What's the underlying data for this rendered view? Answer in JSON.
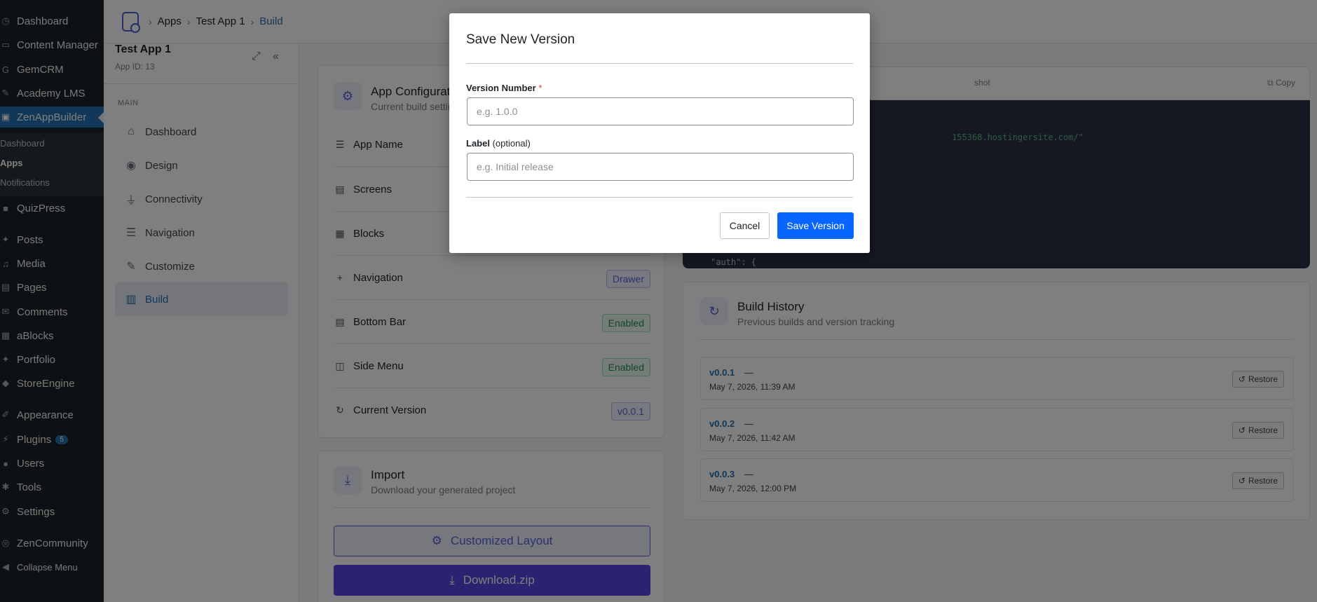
{
  "wp_menu": {
    "items": [
      {
        "label": "Dashboard",
        "icon": "dashboard-icon"
      },
      {
        "label": "Content Manager",
        "icon": "folder-icon"
      },
      {
        "label": "GemCRM",
        "icon": "gem-icon"
      },
      {
        "label": "Academy LMS",
        "icon": "graduation-icon"
      },
      {
        "label": "ZenAppBuilder",
        "icon": "app-icon"
      },
      {
        "label": "QuizPress",
        "icon": "quiz-icon"
      },
      {
        "label": "Posts",
        "icon": "pin-icon"
      },
      {
        "label": "Media",
        "icon": "media-icon"
      },
      {
        "label": "Pages",
        "icon": "page-icon"
      },
      {
        "label": "Comments",
        "icon": "comment-icon"
      },
      {
        "label": "aBlocks",
        "icon": "blocks-icon"
      },
      {
        "label": "Portfolio",
        "icon": "pin-icon"
      },
      {
        "label": "StoreEngine",
        "icon": "store-icon"
      },
      {
        "label": "Appearance",
        "icon": "brush-icon"
      },
      {
        "label": "Plugins",
        "icon": "plugin-icon",
        "badge": "5"
      },
      {
        "label": "Users",
        "icon": "user-icon"
      },
      {
        "label": "Tools",
        "icon": "wrench-icon"
      },
      {
        "label": "Settings",
        "icon": "settings-icon"
      },
      {
        "label": "ZenCommunity",
        "icon": "community-icon"
      },
      {
        "label": "Collapse Menu",
        "icon": "collapse-icon"
      }
    ],
    "submenu": [
      "Dashboard",
      "Apps",
      "Notifications"
    ]
  },
  "breadcrumb": {
    "apps": "Apps",
    "app": "Test App 1",
    "current": "Build"
  },
  "app_sidebar": {
    "title": "Test App 1",
    "app_id": "App ID: 13",
    "section": "MAIN",
    "nav": [
      "Dashboard",
      "Design",
      "Connectivity",
      "Navigation",
      "Customize",
      "Build"
    ]
  },
  "config_card": {
    "title": "App Configuratio",
    "subtitle": "Current build settin",
    "rows": [
      {
        "label": "App Name",
        "badge": ""
      },
      {
        "label": "Screens",
        "badge": ""
      },
      {
        "label": "Blocks",
        "badge": ""
      },
      {
        "label": "Navigation",
        "badge": "Drawer"
      },
      {
        "label": "Bottom Bar",
        "badge": "Enabled"
      },
      {
        "label": "Side Menu",
        "badge": "Enabled"
      },
      {
        "label": "Current Version",
        "badge": "v0.0.1"
      }
    ]
  },
  "import_card": {
    "title": "Import",
    "subtitle": "Download your generated project",
    "btn_layout": "Customized Layout",
    "btn_download": "Download.zip"
  },
  "snapshot": {
    "tab_label": "shot",
    "copy_label": "Copy",
    "url_line": "155368.hostingersite.com/\"",
    "auth_line": "\"auth\": {"
  },
  "history": {
    "title": "Build History",
    "subtitle": "Previous builds and version tracking",
    "restore_label": "Restore",
    "items": [
      {
        "version": "v0.0.1",
        "dash": "—",
        "date": "May 7, 2026, 11:39 AM"
      },
      {
        "version": "v0.0.2",
        "dash": "—",
        "date": "May 7, 2026, 11:42 AM"
      },
      {
        "version": "v0.0.3",
        "dash": "—",
        "date": "May 7, 2026, 12:00 PM"
      }
    ]
  },
  "modal": {
    "title": "Save New Version",
    "version_label": "Version Number",
    "required_mark": "*",
    "version_placeholder": "e.g. 1.0.0",
    "label_label": "Label",
    "label_optional": "(optional)",
    "label_placeholder": "e.g. Initial release",
    "cancel": "Cancel",
    "save": "Save Version"
  },
  "colors": {
    "accent": "#0866ff",
    "wp_active": "#2271b1",
    "purple": "#5562d6"
  }
}
